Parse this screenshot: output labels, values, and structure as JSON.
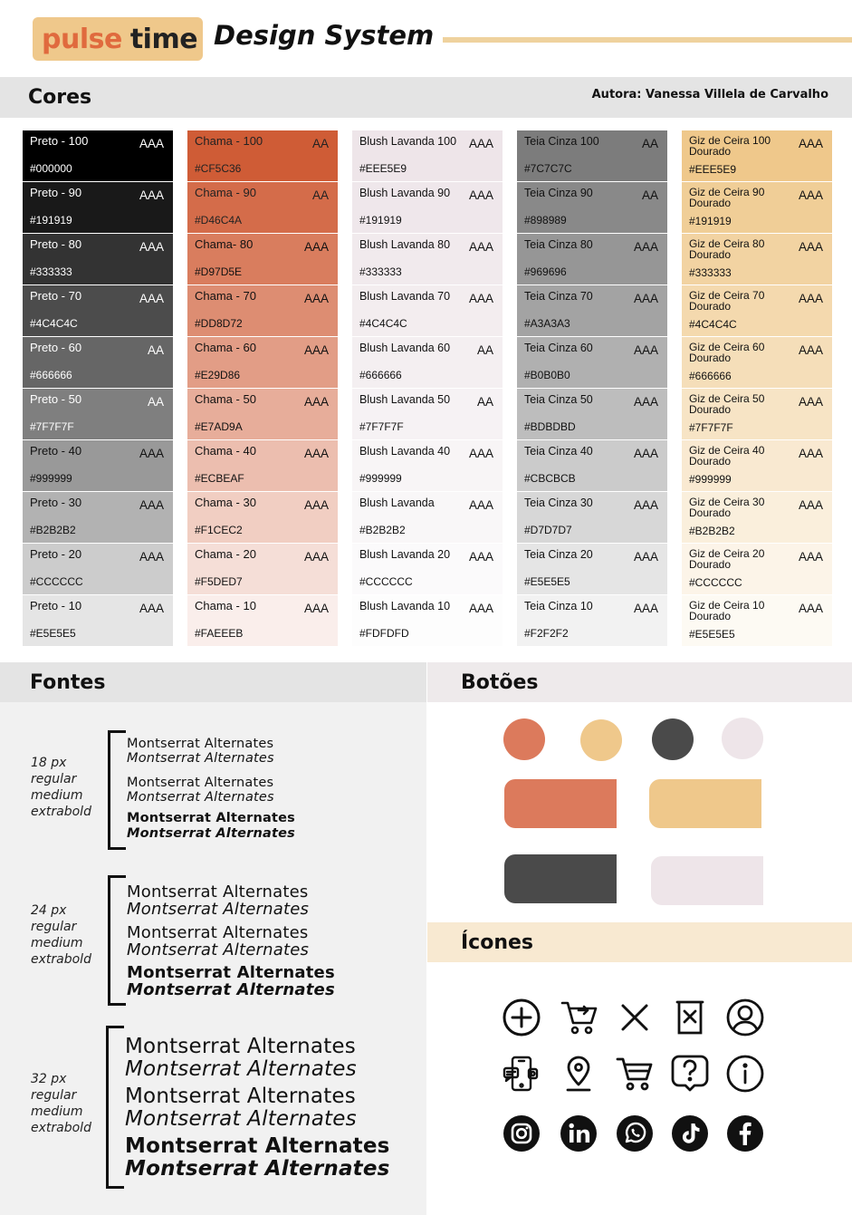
{
  "header": {
    "logo_pulse": "pulse",
    "logo_time": "time",
    "title": "Design System"
  },
  "sections": {
    "cores": "Cores",
    "author": "Autora: Vanessa Villela de Carvalho",
    "fontes": "Fontes",
    "botoes": "Botões",
    "icones": "Ícones"
  },
  "palette": {
    "columns": [
      {
        "id": "preto",
        "text_color_light": "#ffffff",
        "text_color_dark": "#111111",
        "swatches": [
          {
            "name": "Preto - 100",
            "rating": "AAA",
            "hex": "#000000",
            "bg": "#000000"
          },
          {
            "name": "Preto - 90",
            "rating": "AAA",
            "hex": "#191919",
            "bg": "#191919"
          },
          {
            "name": "Preto - 80",
            "rating": "AAA",
            "hex": "#333333",
            "bg": "#333333"
          },
          {
            "name": "Preto - 70",
            "rating": "AAA",
            "hex": "#4C4C4C",
            "bg": "#4C4C4C"
          },
          {
            "name": "Preto - 60",
            "rating": "AA",
            "hex": "#666666",
            "bg": "#666666"
          },
          {
            "name": "Preto - 50",
            "rating": "AA",
            "hex": "#7F7F7F",
            "bg": "#7F7F7F"
          },
          {
            "name": "Preto - 40",
            "rating": "AAA",
            "hex": "#999999",
            "bg": "#999999"
          },
          {
            "name": "Preto - 30",
            "rating": "AAA",
            "hex": "#B2B2B2",
            "bg": "#B2B2B2"
          },
          {
            "name": "Preto - 20",
            "rating": "AAA",
            "hex": "#CCCCCC",
            "bg": "#CCCCCC"
          },
          {
            "name": "Preto - 10",
            "rating": "AAA",
            "hex": "#E5E5E5",
            "bg": "#E5E5E5"
          }
        ]
      },
      {
        "id": "chama",
        "swatches": [
          {
            "name": "Chama - 100",
            "rating": "AA",
            "hex": "#CF5C36",
            "bg": "#CF5C36"
          },
          {
            "name": "Chama - 90",
            "rating": "AA",
            "hex": "#D46C4A",
            "bg": "#D46C4A"
          },
          {
            "name": "Chama- 80",
            "rating": "AAA",
            "hex": "#D97D5E",
            "bg": "#D97D5E"
          },
          {
            "name": "Chama - 70",
            "rating": "AAA",
            "hex": "#DD8D72",
            "bg": "#DD8D72"
          },
          {
            "name": "Chama - 60",
            "rating": "AAA",
            "hex": "#E29D86",
            "bg": "#E29D86"
          },
          {
            "name": "Chama - 50",
            "rating": "AAA",
            "hex": "#E7AD9A",
            "bg": "#E7AD9A"
          },
          {
            "name": "Chama - 40",
            "rating": "AAA",
            "hex": "#ECBEAF",
            "bg": "#ECBEAF"
          },
          {
            "name": "Chama - 30",
            "rating": "AAA",
            "hex": "#F1CEC2",
            "bg": "#F1CEC2"
          },
          {
            "name": "Chama - 20",
            "rating": "AAA",
            "hex": "#F5DED7",
            "bg": "#F5DED7"
          },
          {
            "name": "Chama - 10",
            "rating": "AAA",
            "hex": "#FAEEEB",
            "bg": "#FAEEEB"
          }
        ]
      },
      {
        "id": "blush",
        "swatches": [
          {
            "name": "Blush Lavanda 100",
            "rating": "AAA",
            "hex": "#EEE5E9",
            "bg": "#EEE5E9"
          },
          {
            "name": "Blush Lavanda 90",
            "rating": "AAA",
            "hex": "#191919",
            "bg": "#EFE7EB"
          },
          {
            "name": "Blush Lavanda 80",
            "rating": "AAA",
            "hex": "#333333",
            "bg": "#F1EAED"
          },
          {
            "name": "Blush Lavanda 70",
            "rating": "AAA",
            "hex": "#4C4C4C",
            "bg": "#F3EDEF"
          },
          {
            "name": "Blush Lavanda 60",
            "rating": "AA",
            "hex": "#666666",
            "bg": "#F4EFF1"
          },
          {
            "name": "Blush Lavanda 50",
            "rating": "AA",
            "hex": "#7F7F7F",
            "bg": "#F6F2F4"
          },
          {
            "name": "Blush Lavanda 40",
            "rating": "AAA",
            "hex": "#999999",
            "bg": "#F8F5F6"
          },
          {
            "name": "Blush Lavanda",
            "rating": "AAA",
            "hex": "#B2B2B2",
            "bg": "#F9F7F8"
          },
          {
            "name": "Blush Lavanda 20",
            "rating": "AAA",
            "hex": "#CCCCCC",
            "bg": "#FBFAFB"
          },
          {
            "name": "Blush Lavanda 10",
            "rating": "AAA",
            "hex": "#FDFDFD",
            "bg": "#FDFDFD"
          }
        ]
      },
      {
        "id": "teia",
        "swatches": [
          {
            "name": "Teia Cinza 100",
            "rating": "AA",
            "hex": "#7C7C7C",
            "bg": "#7C7C7C"
          },
          {
            "name": "Teia Cinza 90",
            "rating": "AA",
            "hex": "#898989",
            "bg": "#898989"
          },
          {
            "name": "Teia Cinza  80",
            "rating": "AAA",
            "hex": "#969696",
            "bg": "#969696"
          },
          {
            "name": "Teia Cinza 70",
            "rating": "AAA",
            "hex": "#A3A3A3",
            "bg": "#A3A3A3"
          },
          {
            "name": "Teia Cinza 60",
            "rating": "AAA",
            "hex": "#B0B0B0",
            "bg": "#B0B0B0"
          },
          {
            "name": "Teia Cinza 50",
            "rating": "AAA",
            "hex": "#BDBDBD",
            "bg": "#BDBDBD"
          },
          {
            "name": "Teia Cinza 40",
            "rating": "AAA",
            "hex": "#CBCBCB",
            "bg": "#CBCBCB"
          },
          {
            "name": "Teia Cinza 30",
            "rating": "AAA",
            "hex": "#D7D7D7",
            "bg": "#D7D7D7"
          },
          {
            "name": "Teia Cinza  20",
            "rating": "AAA",
            "hex": "#E5E5E5",
            "bg": "#E5E5E5"
          },
          {
            "name": "Teia Cinza 10",
            "rating": "AAA",
            "hex": "#F2F2F2",
            "bg": "#F2F2F2"
          }
        ]
      },
      {
        "id": "giz",
        "swatches": [
          {
            "name": "Giz de Ceira  100 Dourado",
            "rating": "AAA",
            "hex": "#EEE5E9",
            "bg": "#EFC88B"
          },
          {
            "name": "Giz de Ceira  90 Dourado",
            "rating": "AAA",
            "hex": "#191919",
            "bg": "#F0CE97"
          },
          {
            "name": "Giz de Ceira  80 Dourado",
            "rating": "AAA",
            "hex": "#333333",
            "bg": "#F2D3A2"
          },
          {
            "name": "Giz de Ceira  70 Dourado",
            "rating": "AAA",
            "hex": "#4C4C4C",
            "bg": "#F4D9AE"
          },
          {
            "name": "Giz de Ceira  60 Dourado",
            "rating": "AAA",
            "hex": "#666666",
            "bg": "#F5DEB9"
          },
          {
            "name": "Giz de Ceira  50 Dourado",
            "rating": "AAA",
            "hex": "#7F7F7F",
            "bg": "#F7E4C5"
          },
          {
            "name": "Giz de Ceira  40 Dourado",
            "rating": "AAA",
            "hex": "#999999",
            "bg": "#F9E9D1"
          },
          {
            "name": "Giz de Ceira  30 Dourado",
            "rating": "AAA",
            "hex": "#B2B2B2",
            "bg": "#FAEFDC"
          },
          {
            "name": "Giz de Ceira  20 Dourado",
            "rating": "AAA",
            "hex": "#CCCCCC",
            "bg": "#FCF4E8"
          },
          {
            "name": "Giz de Ceira  10 Dourado",
            "rating": "AAA",
            "hex": "#E5E5E5",
            "bg": "#FDFAF3"
          }
        ]
      }
    ]
  },
  "fonts": {
    "groups": [
      {
        "size": "18 px",
        "weights": [
          "regular",
          "medium",
          "extrabold"
        ],
        "samples": [
          "Montserrat Alternates",
          "Montserrat Alternates",
          "Montserrat Alternates",
          "Montserrat Alternates",
          "Montserrat Alternates",
          "Montserrat Alternates"
        ]
      },
      {
        "size": "24 px",
        "weights": [
          "regular",
          "medium",
          "extrabold"
        ],
        "samples": [
          "Montserrat Alternates",
          "Montserrat Alternates",
          "Montserrat Alternates",
          "Montserrat Alternates",
          "Montserrat Alternates",
          "Montserrat Alternates"
        ]
      },
      {
        "size": "32 px",
        "weights": [
          "regular",
          "medium",
          "extrabold"
        ],
        "samples": [
          "Montserrat Alternates",
          "Montserrat Alternates",
          "Montserrat Alternates",
          "Montserrat Alternates",
          "Montserrat Alternates",
          "Montserrat Alternates"
        ]
      }
    ]
  },
  "buttons": {
    "colors": [
      "#DC7A5C",
      "#EFC88B",
      "#4A4A4A",
      "#EEE5E9"
    ]
  },
  "icons": [
    "plus-circle-icon",
    "cart-arrow-icon",
    "close-icon",
    "delete-box-icon",
    "user-circle-icon",
    "mobile-chat-icon",
    "location-pin-icon",
    "cart-icon",
    "help-icon",
    "info-icon",
    "instagram-icon",
    "linkedin-icon",
    "whatsapp-icon",
    "tiktok-icon",
    "facebook-icon"
  ]
}
